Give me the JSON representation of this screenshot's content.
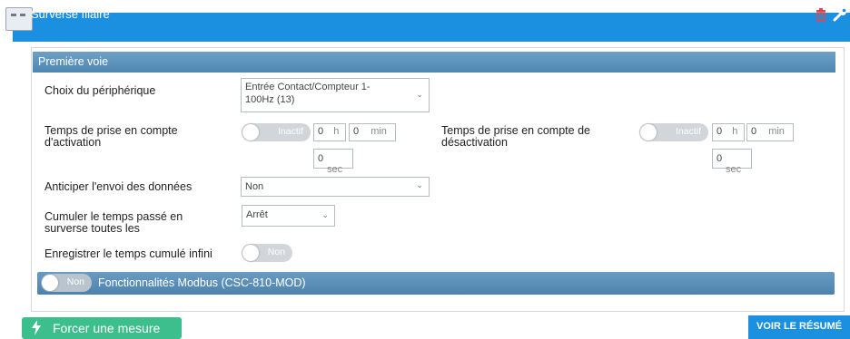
{
  "header": {
    "title": "Surverse filaire"
  },
  "section": {
    "title": "Première voie"
  },
  "device": {
    "label": "Choix du périphérique",
    "value_line1": "Entrée Contact/Compteur 1-",
    "value_line2": "100Hz (13)"
  },
  "activation": {
    "label_line1": "Temps de prise en compte",
    "label_line2": "d'activation",
    "toggle": "Inactif",
    "hours": "0",
    "hours_unit": "h",
    "minutes": "0",
    "minutes_unit": "min",
    "seconds": "0",
    "seconds_unit": "sec"
  },
  "deactivation": {
    "label_line1": "Temps de prise en compte de",
    "label_line2": "désactivation",
    "toggle": "Inactif",
    "hours": "0",
    "hours_unit": "h",
    "minutes": "0",
    "minutes_unit": "min",
    "seconds": "0",
    "seconds_unit": "sec"
  },
  "anticipate": {
    "label": "Anticiper l'envoi des données",
    "value": "Non"
  },
  "cumulate": {
    "label_line1": "Cumuler le temps passé en",
    "label_line2": "surverse toutes les",
    "value": "Arrêt"
  },
  "record": {
    "label": "Enregistrer le temps cumulé infini",
    "toggle": "Non"
  },
  "modbus": {
    "toggle": "Non",
    "label": "Fonctionnalités Modbus (CSC-810-MOD)"
  },
  "footer": {
    "force_label": "Forcer une mesure",
    "resume_label": "VOIR LE RÉSUMÉ"
  },
  "colors": {
    "header": "#1b8fe0",
    "section": "#5a8fb8",
    "force": "#3dbf8d",
    "trash": "#e2474d"
  },
  "icons": [
    "window-icon",
    "trash-icon",
    "wrench-icon",
    "dropdown-caret-icon",
    "bolt-icon"
  ]
}
